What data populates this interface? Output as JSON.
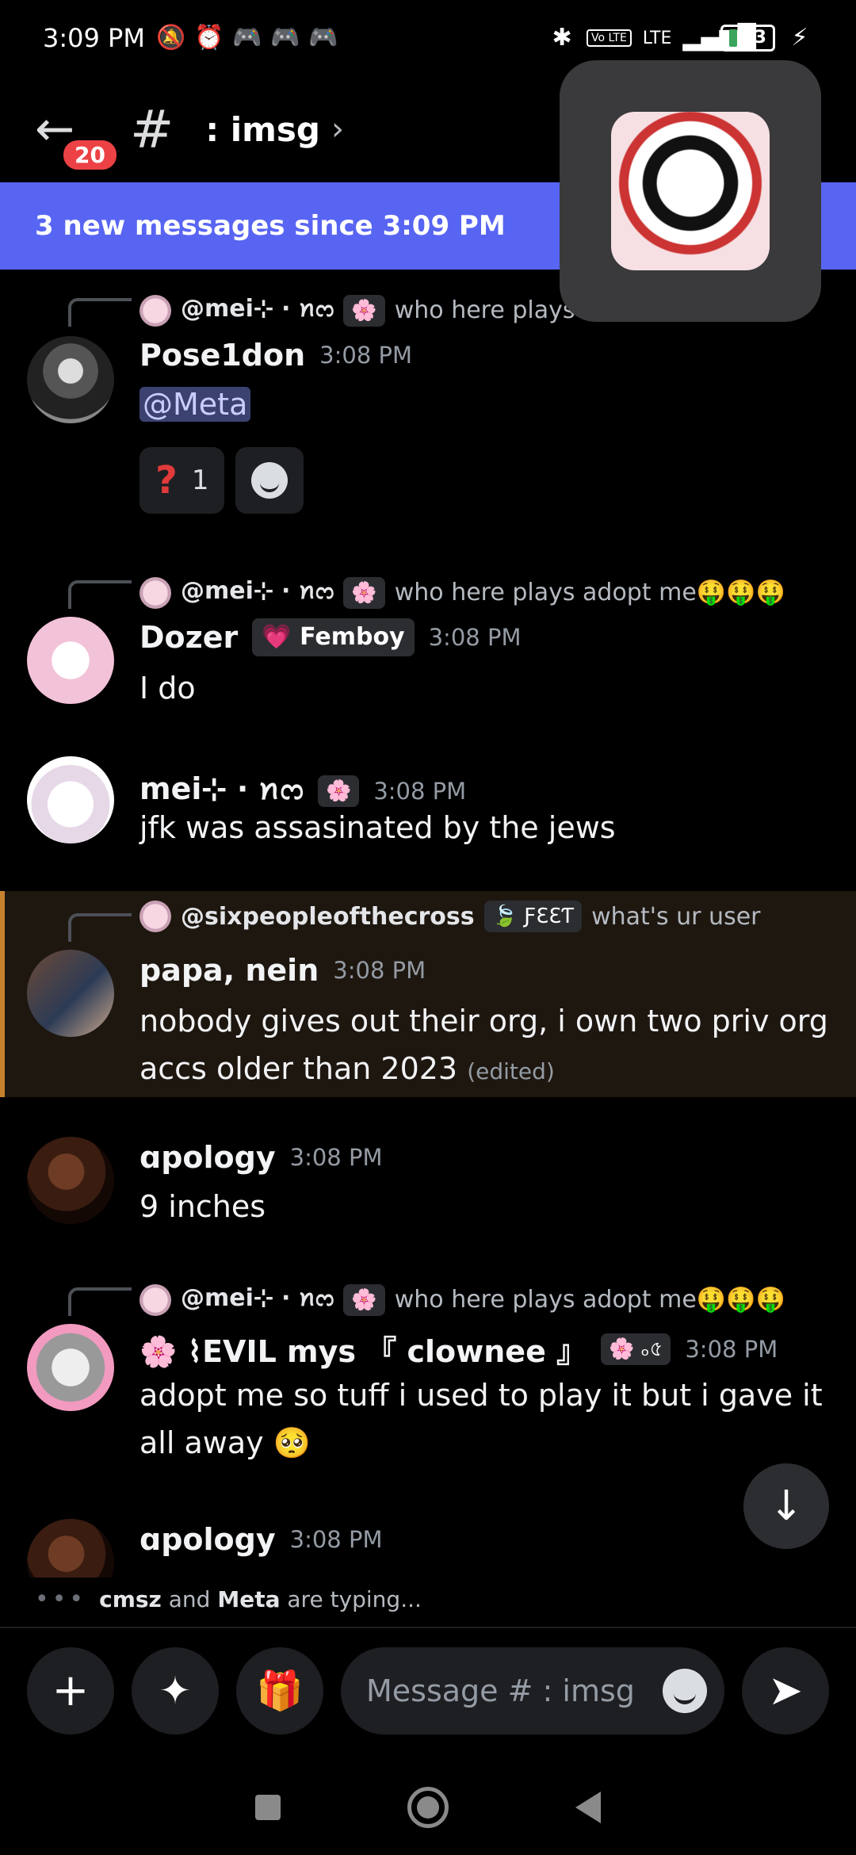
{
  "status_bar": {
    "time": "3:09 PM",
    "battery": "13",
    "network": "LTE",
    "volte": "Vo LTE",
    "icons": [
      "mute-icon",
      "alarm-icon",
      "game-controller-icon",
      "bluetooth-icon",
      "signal-icon",
      "charging-icon"
    ]
  },
  "header": {
    "back_icon": "←",
    "unread_count": "20",
    "hash_icon": "#",
    "channel_name": ": imsg",
    "chevron": "›"
  },
  "banner": {
    "text": "3 new messages since 3:09 PM"
  },
  "messages": [
    {
      "reply": {
        "name": "@mei⊹ ‧ ꪀᦂ",
        "tag": "🌸",
        "text": "who here plays ad"
      },
      "username": "Pose1don",
      "time": "3:08 PM",
      "mention": "@Meta",
      "reactions": [
        {
          "emoji": "❓",
          "count": "1"
        }
      ]
    },
    {
      "reply": {
        "name": "@mei⊹ ‧ ꪀᦂ",
        "tag": "🌸",
        "text": "who here plays adopt me🤑🤑🤑"
      },
      "username": "Dozer",
      "role": "💗 Femboy",
      "time": "3:08 PM",
      "body": "I do"
    },
    {
      "username": "mei⊹ ‧ ꪀᦂ",
      "tag": "🌸",
      "time": "3:08 PM",
      "body": "jfk was assasinated by the jews"
    },
    {
      "reply": {
        "name": "@sixpeopleofthecross",
        "tag": "🍃 ƑƐƐƬ",
        "text": "what's ur user"
      },
      "username": "papa, nein",
      "time": "3:08 PM",
      "body": "nobody gives out their org, i own two priv org accs older than 2023",
      "edited": "(edited)"
    },
    {
      "username": "ɑpology",
      "time": "3:08 PM",
      "body": "9 inches"
    },
    {
      "reply": {
        "name": "@mei⊹ ‧ ꪀᦂ",
        "tag": "🌸",
        "text": "who here plays adopt me🤑🤑🤑"
      },
      "username": "🌸 ⌇EVIL mys 『 clownee 』",
      "tag": "🌸 ₒ৫",
      "time": "3:08 PM",
      "body": "adopt me so tuff i used to play it but i gave it all away 🥺"
    },
    {
      "username": "ɑpology",
      "time": "3:08 PM"
    }
  ],
  "typing": {
    "users_a": "cmsz",
    "and": "and",
    "users_b": "Meta",
    "suffix": "are typing..."
  },
  "composer": {
    "placeholder": "Message # : imsg",
    "plus_icon": "+",
    "apps_icon": "✦",
    "gift_icon": "🎁",
    "send_icon": "➤"
  },
  "scroll_down_icon": "↓"
}
